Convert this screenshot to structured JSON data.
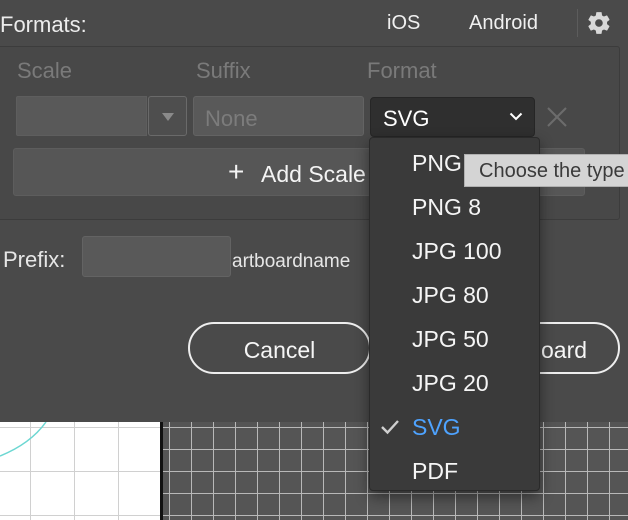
{
  "header": {
    "title": "Formats:",
    "tabs": [
      "iOS",
      "Android"
    ],
    "settings_icon": "gear-icon"
  },
  "columns": {
    "scale": "Scale",
    "suffix": "Suffix",
    "format": "Format"
  },
  "row": {
    "scale_value": "",
    "suffix_placeholder": "None",
    "format_value": "SVG",
    "remove_icon": "close-icon"
  },
  "add_scale": {
    "label": "+ Add Scale",
    "icon": "+",
    "text": "Add Scale"
  },
  "prefix": {
    "label": "Prefix:",
    "value": "",
    "hint": "artboardname"
  },
  "buttons": {
    "cancel": "Cancel",
    "export": "oard"
  },
  "tooltip": {
    "text": "Choose the type"
  },
  "format_menu": {
    "items": [
      {
        "label": "PNG",
        "selected": false
      },
      {
        "label": "PNG 8",
        "selected": false
      },
      {
        "label": "JPG 100",
        "selected": false
      },
      {
        "label": "JPG 80",
        "selected": false
      },
      {
        "label": "JPG 50",
        "selected": false
      },
      {
        "label": "JPG 20",
        "selected": false
      },
      {
        "label": "SVG",
        "selected": true
      },
      {
        "label": "PDF",
        "selected": false
      }
    ],
    "selected_color": "#4ea3ff"
  },
  "colors": {
    "background": "#4a4a4a",
    "menu": "#3a3a3a",
    "selected": "#4ea3ff",
    "artboard_line": "#000000"
  }
}
